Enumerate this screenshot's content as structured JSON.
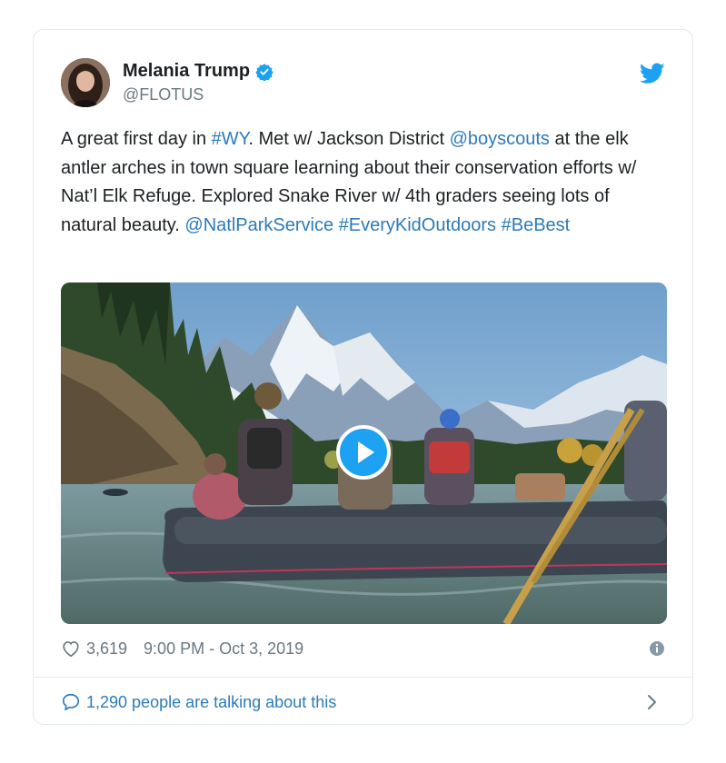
{
  "user": {
    "display_name": "Melania Trump",
    "handle": "@FLOTUS",
    "verified_icon": "verified-badge-icon",
    "avatar": "profile-avatar"
  },
  "brand": {
    "icon": "twitter-bird-icon",
    "color": "#1da1f2"
  },
  "tweet": {
    "segments": [
      {
        "text": "A great first day in ",
        "link": false
      },
      {
        "text": "#WY",
        "link": true
      },
      {
        "text": ". Met w/ Jackson District ",
        "link": false
      },
      {
        "text": "@boyscouts",
        "link": true
      },
      {
        "text": " at the elk antler arches in town square learning about their conservation efforts w/ Nat’l Elk Refuge. Explored Snake River w/ 4th graders seeing lots of natural beauty. ",
        "link": false
      },
      {
        "text": "@NatlParkService",
        "link": true
      },
      {
        "text": " ",
        "link": false
      },
      {
        "text": "#EveryKidOutdoors",
        "link": true
      },
      {
        "text": " ",
        "link": false
      },
      {
        "text": "#BeBest",
        "link": true
      }
    ],
    "link_color": "#2b7bb9",
    "text_color": "#1c2022"
  },
  "media": {
    "type": "video",
    "play_icon": "play-icon",
    "description_icon": "video-thumbnail"
  },
  "meta": {
    "heart_icon": "heart-icon",
    "likes": "3,619",
    "timestamp": "9:00 PM - Oct 3, 2019",
    "info_icon": "info-icon"
  },
  "footer": {
    "bubble_icon": "speech-bubble-icon",
    "talking_label": "1,290 people are talking about this",
    "chevron_icon": "chevron-right-icon"
  }
}
